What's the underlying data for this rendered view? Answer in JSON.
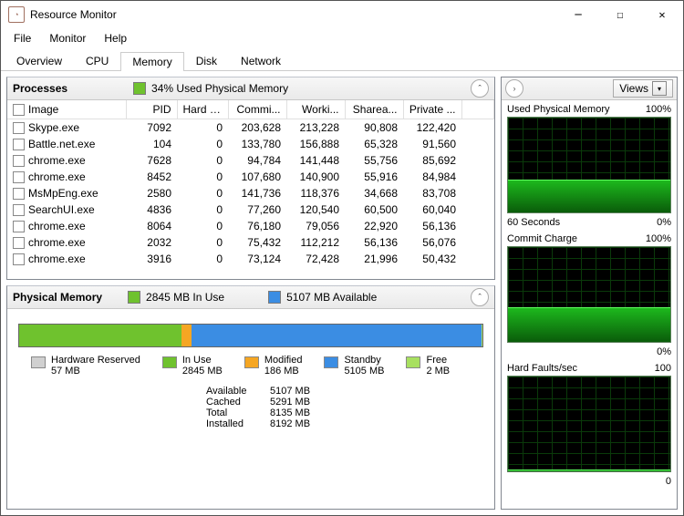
{
  "window": {
    "title": "Resource Monitor"
  },
  "menu": {
    "file": "File",
    "monitor": "Monitor",
    "help": "Help"
  },
  "tabs": {
    "overview": "Overview",
    "cpu": "CPU",
    "memory": "Memory",
    "disk": "Disk",
    "network": "Network"
  },
  "processes": {
    "title": "Processes",
    "usage_text": "34% Used Physical Memory",
    "columns": {
      "image": "Image",
      "pid": "PID",
      "hard": "Hard F...",
      "commit": "Commi...",
      "working": "Worki...",
      "shareable": "Sharea...",
      "private": "Private ..."
    },
    "rows": [
      {
        "image": "Skype.exe",
        "pid": "7092",
        "hard": "0",
        "commit": "203,628",
        "working": "213,228",
        "shareable": "90,808",
        "private": "122,420"
      },
      {
        "image": "Battle.net.exe",
        "pid": "104",
        "hard": "0",
        "commit": "133,780",
        "working": "156,888",
        "shareable": "65,328",
        "private": "91,560"
      },
      {
        "image": "chrome.exe",
        "pid": "7628",
        "hard": "0",
        "commit": "94,784",
        "working": "141,448",
        "shareable": "55,756",
        "private": "85,692"
      },
      {
        "image": "chrome.exe",
        "pid": "8452",
        "hard": "0",
        "commit": "107,680",
        "working": "140,900",
        "shareable": "55,916",
        "private": "84,984"
      },
      {
        "image": "MsMpEng.exe",
        "pid": "2580",
        "hard": "0",
        "commit": "141,736",
        "working": "118,376",
        "shareable": "34,668",
        "private": "83,708"
      },
      {
        "image": "SearchUI.exe",
        "pid": "4836",
        "hard": "0",
        "commit": "77,260",
        "working": "120,540",
        "shareable": "60,500",
        "private": "60,040"
      },
      {
        "image": "chrome.exe",
        "pid": "8064",
        "hard": "0",
        "commit": "76,180",
        "working": "79,056",
        "shareable": "22,920",
        "private": "56,136"
      },
      {
        "image": "chrome.exe",
        "pid": "2032",
        "hard": "0",
        "commit": "75,432",
        "working": "112,212",
        "shareable": "56,136",
        "private": "56,076"
      },
      {
        "image": "chrome.exe",
        "pid": "3916",
        "hard": "0",
        "commit": "73,124",
        "working": "72,428",
        "shareable": "21,996",
        "private": "50,432"
      }
    ]
  },
  "physmem": {
    "title": "Physical Memory",
    "in_use_summary": "2845 MB In Use",
    "avail_summary": "5107 MB Available",
    "legend": {
      "hardware": {
        "label": "Hardware Reserved",
        "value": "57 MB"
      },
      "inuse": {
        "label": "In Use",
        "value": "2845 MB"
      },
      "modified": {
        "label": "Modified",
        "value": "186 MB"
      },
      "standby": {
        "label": "Standby",
        "value": "5105 MB"
      },
      "free": {
        "label": "Free",
        "value": "2 MB"
      }
    },
    "stats": {
      "available": {
        "label": "Available",
        "value": "5107 MB"
      },
      "cached": {
        "label": "Cached",
        "value": "5291 MB"
      },
      "total": {
        "label": "Total",
        "value": "8135 MB"
      },
      "installed": {
        "label": "Installed",
        "value": "8192 MB"
      }
    }
  },
  "right": {
    "views": "Views",
    "charts": {
      "used": {
        "title": "Used Physical Memory",
        "max": "100%",
        "foot_left": "60 Seconds",
        "foot_right": "0%"
      },
      "commit": {
        "title": "Commit Charge",
        "max": "100%",
        "foot_right": "0%"
      },
      "faults": {
        "title": "Hard Faults/sec",
        "max": "100",
        "foot_right": "0"
      }
    }
  },
  "chart_data": [
    {
      "type": "area",
      "title": "Used Physical Memory",
      "ylabel": "%",
      "ylim": [
        0,
        100
      ],
      "xrange_seconds": 60,
      "approx_level": 34
    },
    {
      "type": "area",
      "title": "Commit Charge",
      "ylabel": "%",
      "ylim": [
        0,
        100
      ],
      "xrange_seconds": 60,
      "approx_level": 36
    },
    {
      "type": "area",
      "title": "Hard Faults/sec",
      "ylabel": "faults/sec",
      "ylim": [
        0,
        100
      ],
      "xrange_seconds": 60,
      "approx_level": 0
    }
  ]
}
